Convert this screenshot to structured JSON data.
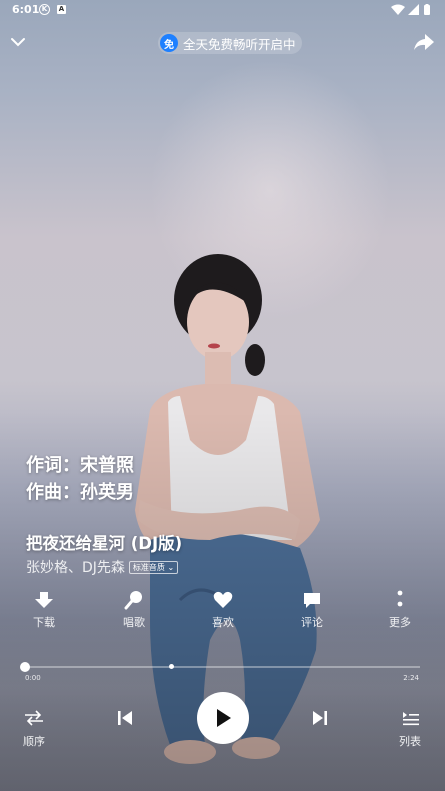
{
  "status_bar": {
    "time": "6:01",
    "icon_k": "K",
    "icon_a": "A"
  },
  "header": {
    "promo_badge": "免",
    "promo_text": "全天免费畅听开启中"
  },
  "credits": {
    "lyricist": "作词：宋普照",
    "composer": "作曲：孙英男"
  },
  "song": {
    "title": "把夜还给星河 (DJ版)",
    "artists": "张妙格、DJ先森",
    "quality": "标准音质"
  },
  "actions": {
    "download": "下载",
    "sing": "唱歌",
    "like": "喜欢",
    "comment": "评论",
    "more": "更多"
  },
  "player": {
    "current_time": "0:00",
    "duration": "2:24",
    "progress": 0.0,
    "buffered": 0.37
  },
  "controls": {
    "mode": "顺序",
    "playlist": "列表"
  },
  "icons": [
    "chevron-down-icon",
    "free-badge-icon",
    "share-icon",
    "download-icon",
    "microphone-icon",
    "heart-icon",
    "comment-icon",
    "more-icon",
    "order-icon",
    "previous-icon",
    "play-icon",
    "next-icon",
    "playlist-icon",
    "wifi-icon",
    "signal-icon",
    "battery-icon"
  ]
}
